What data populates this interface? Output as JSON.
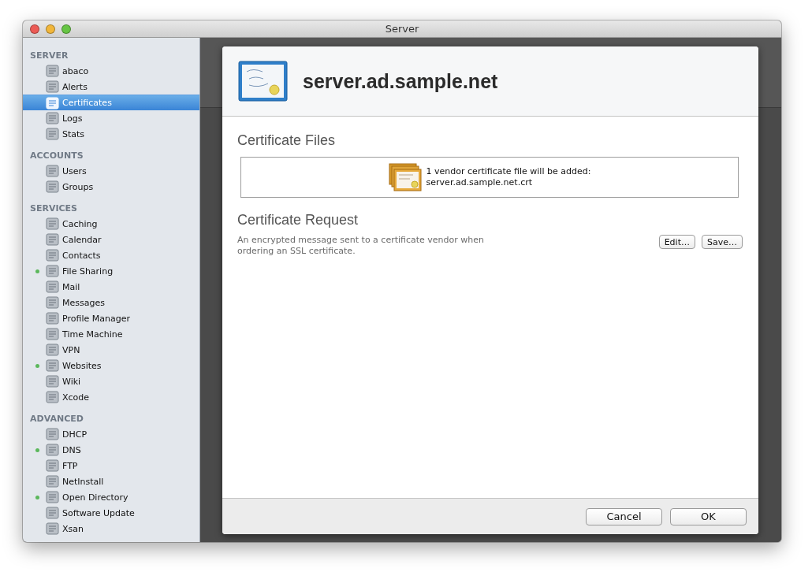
{
  "window": {
    "title": "Server"
  },
  "sidebar": {
    "sections": [
      {
        "heading": "SERVER",
        "items": [
          {
            "label": "abaco",
            "selected": false,
            "running": false
          },
          {
            "label": "Alerts",
            "selected": false,
            "running": false
          },
          {
            "label": "Certificates",
            "selected": true,
            "running": false
          },
          {
            "label": "Logs",
            "selected": false,
            "running": false
          },
          {
            "label": "Stats",
            "selected": false,
            "running": false
          }
        ]
      },
      {
        "heading": "ACCOUNTS",
        "items": [
          {
            "label": "Users",
            "selected": false,
            "running": false
          },
          {
            "label": "Groups",
            "selected": false,
            "running": false
          }
        ]
      },
      {
        "heading": "SERVICES",
        "items": [
          {
            "label": "Caching",
            "selected": false,
            "running": false
          },
          {
            "label": "Calendar",
            "selected": false,
            "running": false
          },
          {
            "label": "Contacts",
            "selected": false,
            "running": false
          },
          {
            "label": "File Sharing",
            "selected": false,
            "running": true
          },
          {
            "label": "Mail",
            "selected": false,
            "running": false
          },
          {
            "label": "Messages",
            "selected": false,
            "running": false
          },
          {
            "label": "Profile Manager",
            "selected": false,
            "running": false
          },
          {
            "label": "Time Machine",
            "selected": false,
            "running": false
          },
          {
            "label": "VPN",
            "selected": false,
            "running": false
          },
          {
            "label": "Websites",
            "selected": false,
            "running": true
          },
          {
            "label": "Wiki",
            "selected": false,
            "running": false
          },
          {
            "label": "Xcode",
            "selected": false,
            "running": false
          }
        ]
      },
      {
        "heading": "ADVANCED",
        "items": [
          {
            "label": "DHCP",
            "selected": false,
            "running": false
          },
          {
            "label": "DNS",
            "selected": false,
            "running": true
          },
          {
            "label": "FTP",
            "selected": false,
            "running": false
          },
          {
            "label": "NetInstall",
            "selected": false,
            "running": false
          },
          {
            "label": "Open Directory",
            "selected": false,
            "running": true
          },
          {
            "label": "Software Update",
            "selected": false,
            "running": false
          },
          {
            "label": "Xsan",
            "selected": false,
            "running": false
          }
        ]
      }
    ]
  },
  "sheet": {
    "title": "server.ad.sample.net",
    "files": {
      "heading": "Certificate Files",
      "lines": [
        "1 vendor certificate file will be added:",
        "server.ad.sample.net.crt"
      ]
    },
    "request": {
      "heading": "Certificate Request",
      "description": "An encrypted message sent to a certificate vendor when ordering an SSL certificate.",
      "buttons": [
        "Edit…",
        "Save…"
      ]
    },
    "buttons": [
      "Cancel",
      "OK"
    ]
  }
}
